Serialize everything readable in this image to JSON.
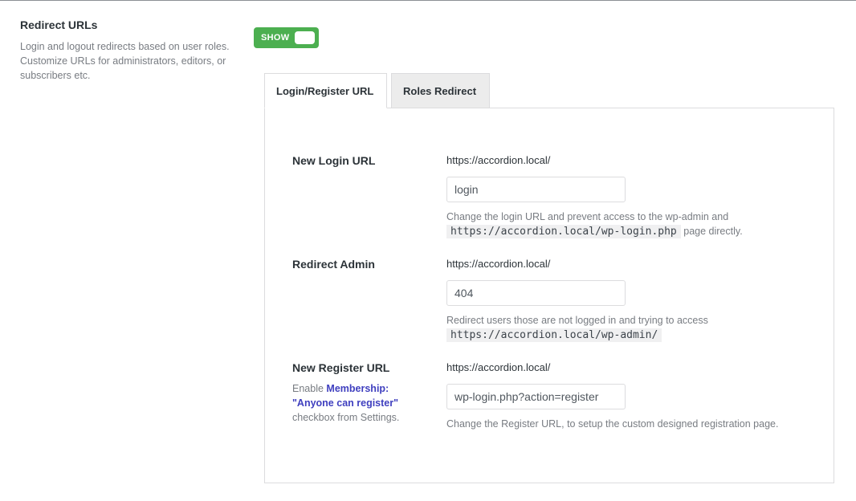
{
  "section": {
    "title": "Redirect URLs",
    "description": "Login and logout redirects based on user roles. Customize URLs for administrators, editors, or subscribers etc."
  },
  "toggle": {
    "label": "SHOW",
    "state": "on",
    "color": "#4caf50"
  },
  "tabs": [
    {
      "label": "Login/Register URL",
      "active": true
    },
    {
      "label": "Roles Redirect",
      "active": false
    }
  ],
  "fields": {
    "login": {
      "label": "New Login URL",
      "prefix": "https://accordion.local/",
      "value": "login",
      "help_text": "Change the login URL and prevent access to the wp-admin and",
      "help_code": "https://accordion.local/wp-login.php",
      "help_suffix": "page directly."
    },
    "admin": {
      "label": "Redirect Admin",
      "prefix": "https://accordion.local/",
      "value": "404",
      "help_text": "Redirect users those are not logged in and trying to access",
      "help_code": "https://accordion.local/wp-admin/"
    },
    "register": {
      "label": "New Register URL",
      "note_before": "Enable",
      "note_link": "Membership: \"Anyone can register\"",
      "note_after": "checkbox from Settings.",
      "prefix": "https://accordion.local/",
      "value": "wp-login.php?action=register",
      "help_text": "Change the Register URL, to setup the custom designed registration page."
    }
  }
}
